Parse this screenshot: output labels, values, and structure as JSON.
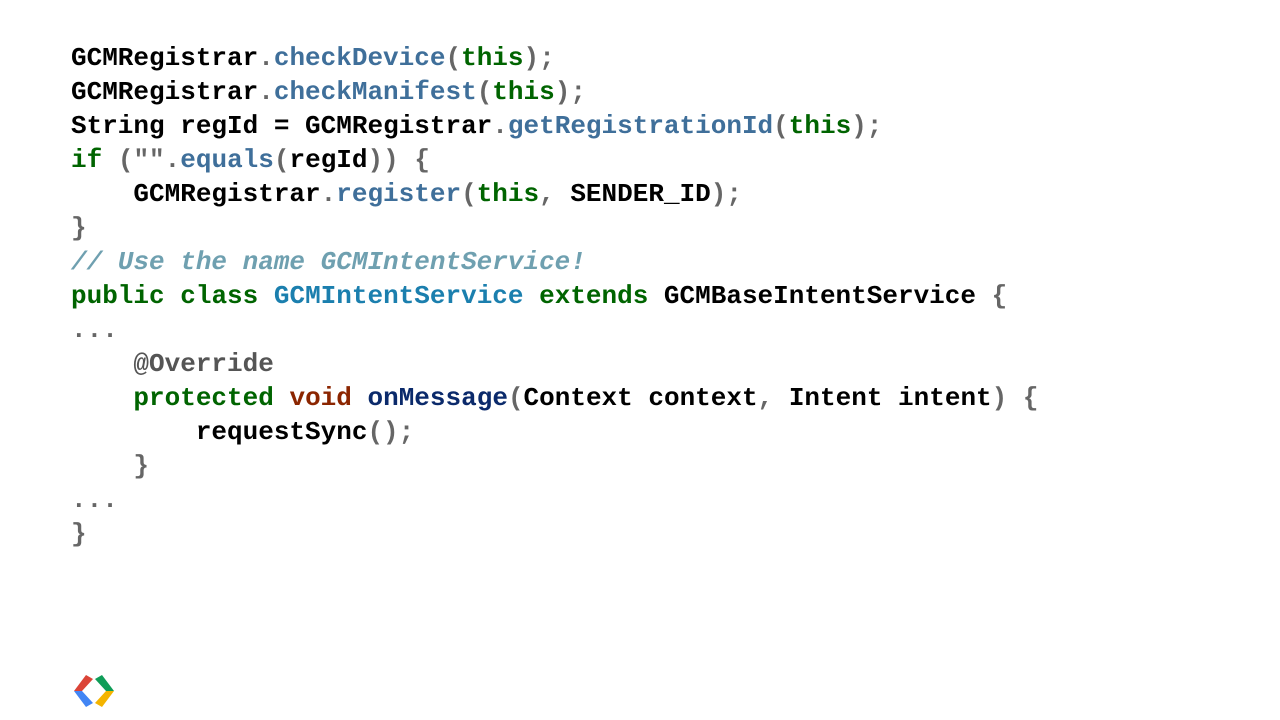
{
  "code": {
    "lines": [
      {
        "tokens": [
          {
            "t": "GCMRegistrar",
            "c": "plain"
          },
          {
            "t": ".",
            "c": "punct"
          },
          {
            "t": "checkDevice",
            "c": "method"
          },
          {
            "t": "(",
            "c": "punct"
          },
          {
            "t": "this",
            "c": "keyword"
          },
          {
            "t": ");",
            "c": "punct"
          }
        ]
      },
      {
        "tokens": [
          {
            "t": "GCMRegistrar",
            "c": "plain"
          },
          {
            "t": ".",
            "c": "punct"
          },
          {
            "t": "checkManifest",
            "c": "method"
          },
          {
            "t": "(",
            "c": "punct"
          },
          {
            "t": "this",
            "c": "keyword"
          },
          {
            "t": ");",
            "c": "punct"
          }
        ]
      },
      {
        "tokens": [
          {
            "t": "String regId ",
            "c": "plain"
          },
          {
            "t": "=",
            "c": "plain"
          },
          {
            "t": " GCMRegistrar",
            "c": "plain"
          },
          {
            "t": ".",
            "c": "punct"
          },
          {
            "t": "getRegistrationId",
            "c": "method"
          },
          {
            "t": "(",
            "c": "punct"
          },
          {
            "t": "this",
            "c": "keyword"
          },
          {
            "t": ");",
            "c": "punct"
          }
        ]
      },
      {
        "tokens": [
          {
            "t": "if",
            "c": "keyword"
          },
          {
            "t": " (",
            "c": "punct"
          },
          {
            "t": "\"\"",
            "c": "string"
          },
          {
            "t": ".",
            "c": "punct"
          },
          {
            "t": "equals",
            "c": "method"
          },
          {
            "t": "(",
            "c": "punct"
          },
          {
            "t": "regId",
            "c": "plain"
          },
          {
            "t": ")) {",
            "c": "punct"
          }
        ]
      },
      {
        "tokens": [
          {
            "t": "    GCMRegistrar",
            "c": "plain"
          },
          {
            "t": ".",
            "c": "punct"
          },
          {
            "t": "register",
            "c": "method"
          },
          {
            "t": "(",
            "c": "punct"
          },
          {
            "t": "this",
            "c": "keyword"
          },
          {
            "t": ", ",
            "c": "punct"
          },
          {
            "t": "SENDER_ID",
            "c": "plain"
          },
          {
            "t": ");",
            "c": "punct"
          }
        ]
      },
      {
        "tokens": [
          {
            "t": "}",
            "c": "punct"
          }
        ]
      },
      {
        "tokens": [
          {
            "t": "// Use the name GCMIntentService!",
            "c": "comment"
          }
        ]
      },
      {
        "tokens": [
          {
            "t": "public",
            "c": "keyword"
          },
          {
            "t": " ",
            "c": "plain"
          },
          {
            "t": "class",
            "c": "keyword"
          },
          {
            "t": " ",
            "c": "plain"
          },
          {
            "t": "GCMIntentService",
            "c": "type"
          },
          {
            "t": " ",
            "c": "plain"
          },
          {
            "t": "extends",
            "c": "keyword"
          },
          {
            "t": " GCMBaseIntentService ",
            "c": "plain"
          },
          {
            "t": "{",
            "c": "punct"
          }
        ]
      },
      {
        "tokens": [
          {
            "t": "...",
            "c": "punct"
          }
        ]
      },
      {
        "tokens": [
          {
            "t": "    @Override",
            "c": "annot"
          }
        ]
      },
      {
        "tokens": [
          {
            "t": "    ",
            "c": "plain"
          },
          {
            "t": "protected",
            "c": "keyword"
          },
          {
            "t": " ",
            "c": "plain"
          },
          {
            "t": "void",
            "c": "type2"
          },
          {
            "t": " ",
            "c": "plain"
          },
          {
            "t": "onMessage",
            "c": "func"
          },
          {
            "t": "(",
            "c": "punct"
          },
          {
            "t": "Context context",
            "c": "plain"
          },
          {
            "t": ", ",
            "c": "punct"
          },
          {
            "t": "Intent intent",
            "c": "plain"
          },
          {
            "t": ") {",
            "c": "punct"
          }
        ]
      },
      {
        "tokens": [
          {
            "t": "        requestSync",
            "c": "plain"
          },
          {
            "t": "();",
            "c": "punct"
          }
        ]
      },
      {
        "tokens": [
          {
            "t": "    }",
            "c": "punct"
          }
        ]
      },
      {
        "tokens": [
          {
            "t": "...",
            "c": "punct"
          }
        ]
      },
      {
        "tokens": [
          {
            "t": "}",
            "c": "punct"
          }
        ]
      }
    ]
  },
  "logo": {
    "icon": "google-developers-logo-icon",
    "colors": {
      "red": "#db4437",
      "blue": "#4285f4",
      "green": "#0f9d58",
      "yellow": "#f4b400"
    }
  }
}
